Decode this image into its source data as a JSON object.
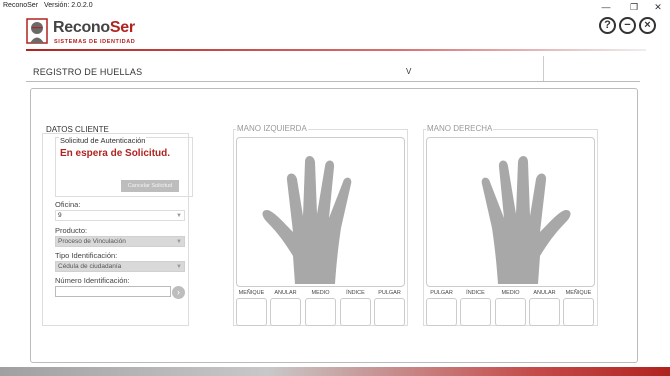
{
  "window": {
    "app_name": "ReconoSer",
    "version_label": "Versión: 2.0.2.0",
    "minimize_glyph": "—",
    "restore_glyph": "❐",
    "close_glyph": "✕"
  },
  "header": {
    "logo_recono": "Recono",
    "logo_ser": "Ser",
    "logo_subtitle": "SISTEMAS DE IDENTIDAD",
    "help_glyph": "?",
    "minimize_glyph": "−",
    "close_glyph": "×",
    "colors": {
      "brand_red": "#b0231f",
      "brand_gray": "#444444"
    }
  },
  "section": {
    "title": "REGISTRO DE HUELLAS",
    "right_label": "V"
  },
  "client": {
    "label": "DATOS CLIENTE",
    "auth_title": "Solicitud de Autenticación",
    "auth_status": "En espera de Solicitud.",
    "cancel_button": "Cancelar Solicitud",
    "oficina_label": "Oficina:",
    "oficina_value": "9",
    "producto_label": "Producto:",
    "producto_value": "Proceso de Vinculación",
    "tipo_label": "Tipo Identificación:",
    "tipo_value": "Cédula de ciudadanía",
    "numero_label": "Número Identificación:",
    "numero_value": "",
    "go_glyph": "›"
  },
  "left_hand": {
    "title": "MANO IZQUIERDA",
    "fingers": [
      "MEÑIQUE",
      "ANULAR",
      "MEDIO",
      "ÍNDICE",
      "PULGAR"
    ]
  },
  "right_hand": {
    "title": "MANO DERECHA",
    "fingers": [
      "PULGAR",
      "ÍNDICE",
      "MEDIO",
      "ANULAR",
      "MEÑIQUE"
    ]
  }
}
